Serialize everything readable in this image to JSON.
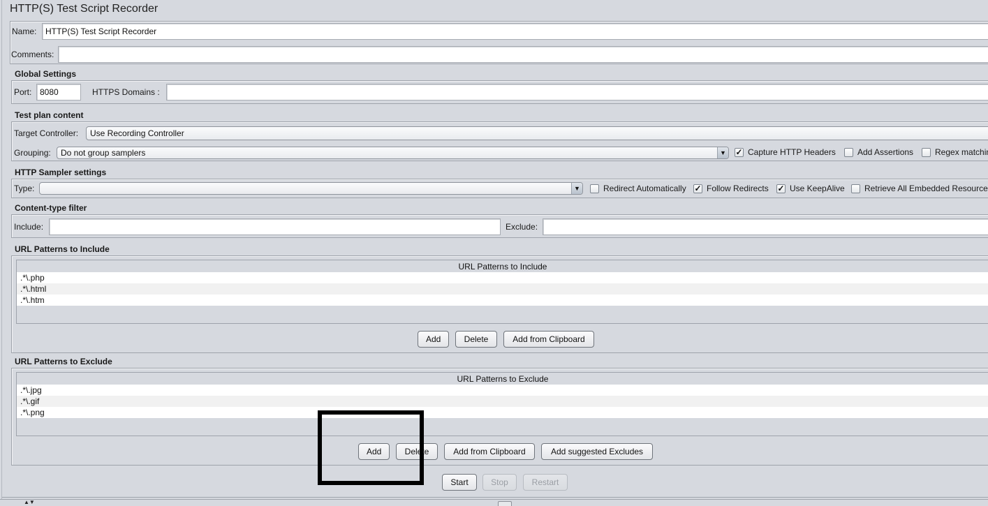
{
  "window": {
    "title": "HTTP(S) Test Script Recorder"
  },
  "name_field": {
    "label": "Name:",
    "value": "HTTP(S) Test Script Recorder"
  },
  "comments_field": {
    "label": "Comments:",
    "value": ""
  },
  "global_settings": {
    "title": "Global Settings",
    "port_label": "Port:",
    "port_value": "8080",
    "https_domains_label": "HTTPS Domains :",
    "https_domains_value": ""
  },
  "test_plan_content": {
    "title": "Test plan content",
    "target_controller_label": "Target Controller:",
    "target_controller_value": "Use Recording Controller",
    "grouping_label": "Grouping:",
    "grouping_value": "Do not group samplers",
    "checkboxes": [
      {
        "label": "Capture HTTP Headers",
        "checked": true
      },
      {
        "label": "Add Assertions",
        "checked": false
      },
      {
        "label": "Regex matching",
        "checked": false
      }
    ]
  },
  "http_sampler_settings": {
    "title": "HTTP Sampler settings",
    "type_label": "Type:",
    "type_value": "",
    "checkboxes": [
      {
        "label": "Redirect Automatically",
        "checked": false
      },
      {
        "label": "Follow Redirects",
        "checked": true
      },
      {
        "label": "Use KeepAlive",
        "checked": true
      },
      {
        "label": "Retrieve All Embedded Resources",
        "checked": false
      }
    ]
  },
  "content_type_filter": {
    "title": "Content-type filter",
    "include_label": "Include:",
    "include_value": "",
    "exclude_label": "Exclude:",
    "exclude_value": ""
  },
  "url_include": {
    "title": "URL Patterns to Include",
    "column_header": "URL Patterns to Include",
    "rows": [
      ".*\\.php",
      ".*\\.html",
      ".*\\.htm"
    ],
    "buttons": {
      "add": "Add",
      "delete": "Delete",
      "add_from_clipboard": "Add from Clipboard"
    }
  },
  "url_exclude": {
    "title": "URL Patterns to Exclude",
    "column_header": "URL Patterns to Exclude",
    "rows": [
      ".*\\.jpg",
      ".*\\.gif",
      ".*\\.png"
    ],
    "buttons": {
      "add": "Add",
      "delete": "Delete",
      "add_from_clipboard": "Add from Clipboard",
      "add_suggested_excludes": "Add suggested Excludes"
    }
  },
  "controls": {
    "start": "Start",
    "stop": "Stop",
    "restart": "Restart",
    "stop_enabled": false,
    "restart_enabled": false
  },
  "checkmark_glyph": "✓",
  "combo_arrow_glyph": "▼"
}
